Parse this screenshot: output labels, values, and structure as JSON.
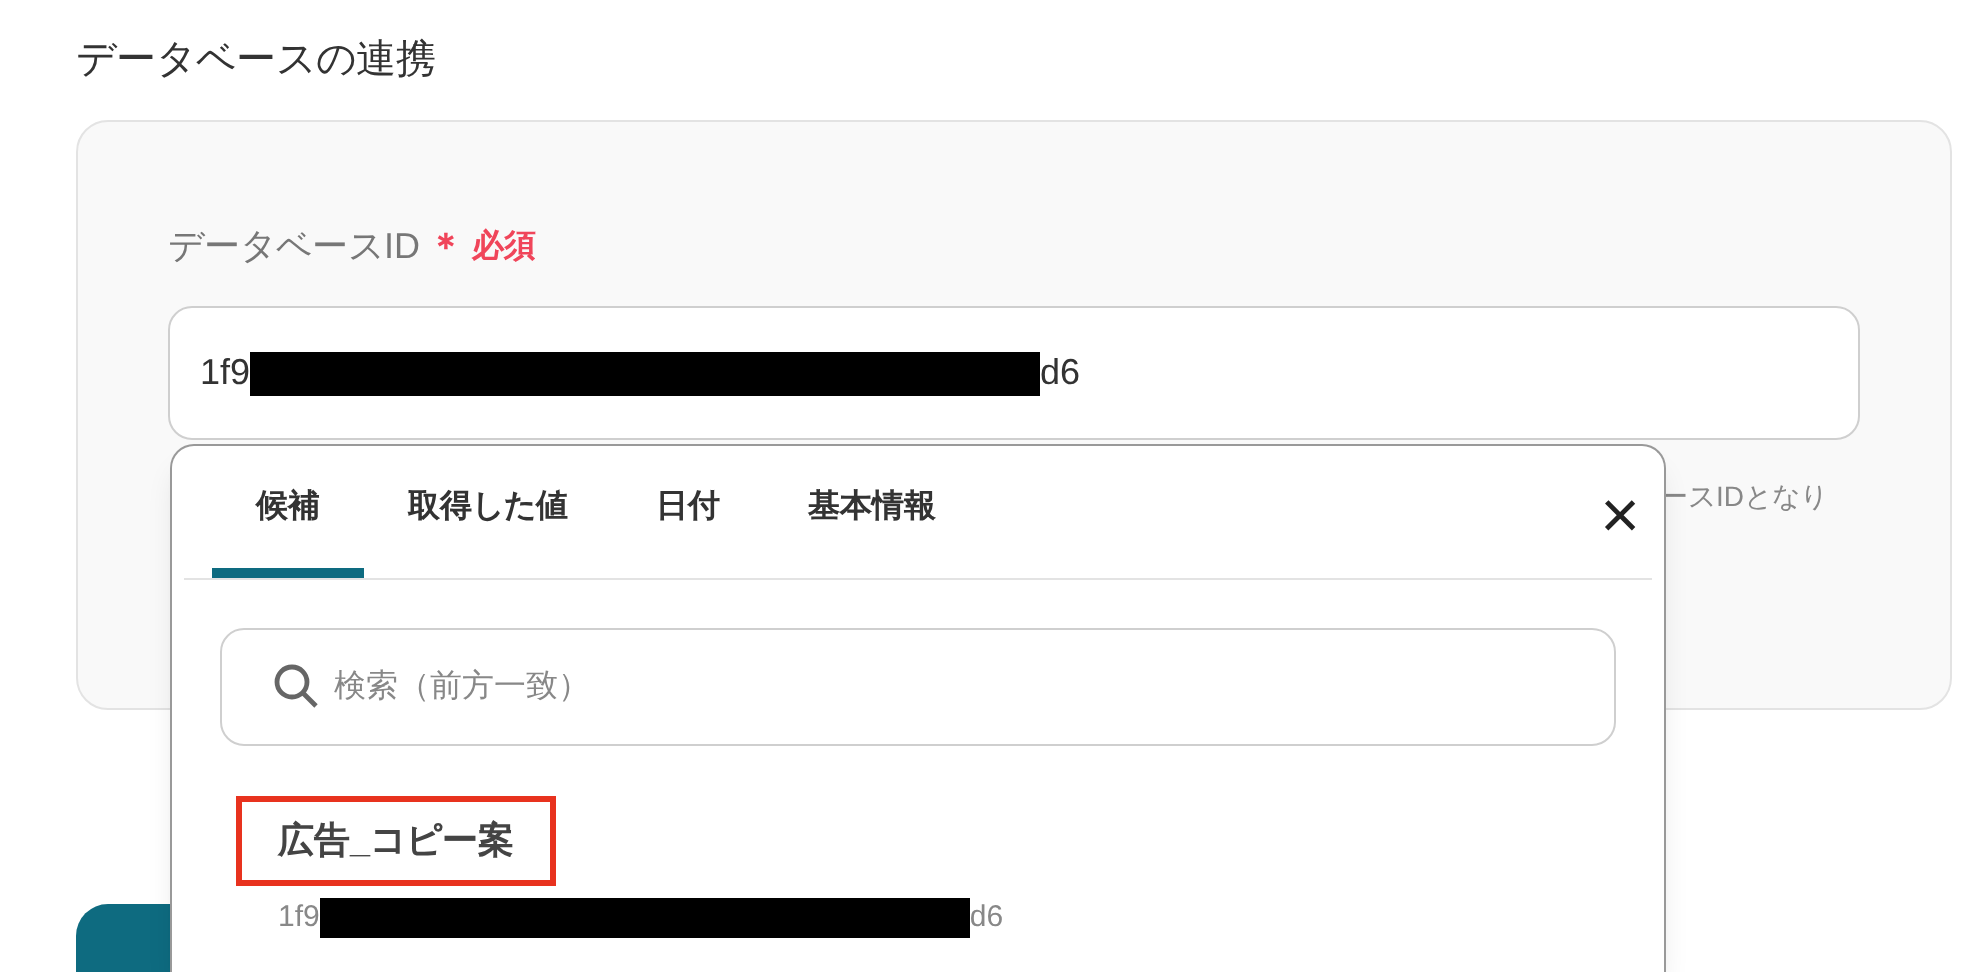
{
  "section_title": "データベースの連携",
  "field": {
    "label": "データベースID",
    "required_mark": "＊",
    "required_text": "必須",
    "value_start": "1f9",
    "value_end": "d6",
    "redacted": true,
    "help_text": "ースIDとなり"
  },
  "popup": {
    "tabs": [
      {
        "label": "候補",
        "selected": true
      },
      {
        "label": "取得した値",
        "selected": false
      },
      {
        "label": "日付",
        "selected": false
      },
      {
        "label": "基本情報",
        "selected": false
      }
    ],
    "close": "×",
    "search": {
      "placeholder": "検索（前方一致）"
    },
    "items": [
      {
        "title": "広告_コピー案",
        "highlighted": true,
        "id_start": "1f9",
        "id_end": "d6",
        "redacted": true
      }
    ]
  }
}
